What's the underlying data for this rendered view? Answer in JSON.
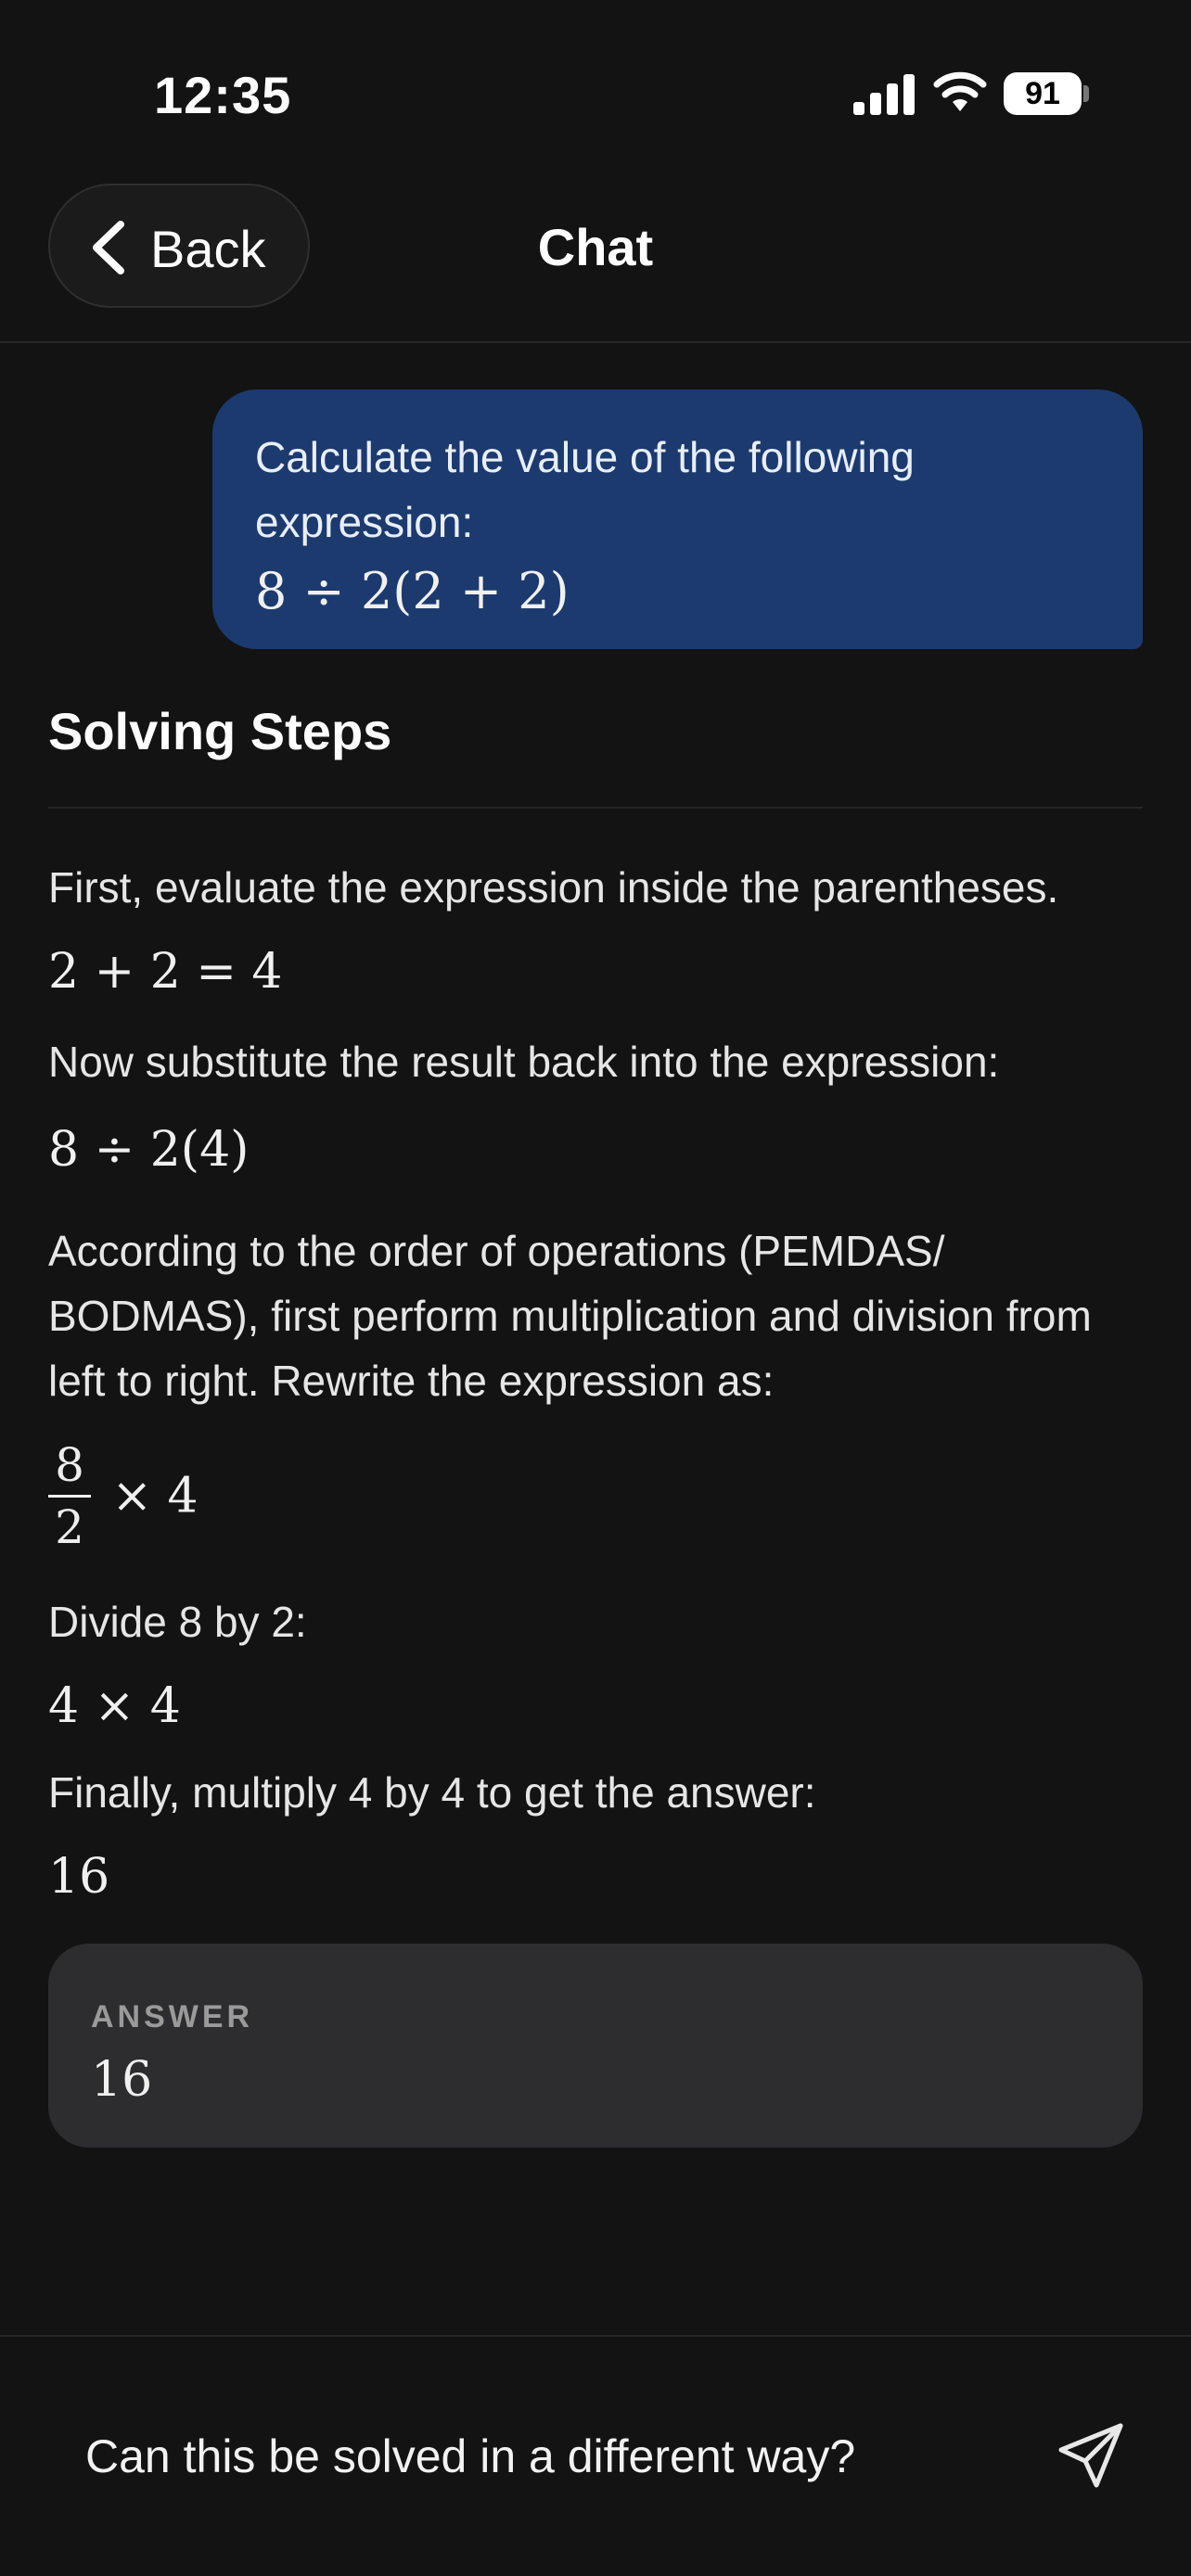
{
  "status": {
    "time": "12:35",
    "battery": "91"
  },
  "nav": {
    "back_label": "Back",
    "title": "Chat"
  },
  "user_message": {
    "text": "Calculate the value of the following expression:",
    "math": "8 ÷ 2(2 + 2)"
  },
  "solution": {
    "title": "Solving Steps",
    "steps": [
      "First, evaluate the expression inside the parentheses.",
      "2 + 2 = 4",
      "Now substitute the result back into the expression:",
      "8 ÷ 2(4)",
      "According to the order of operations (PEMDAS/ BODMAS), first perform multiplication and division from left to right. Rewrite the expression as:",
      "8",
      "2",
      "× 4",
      "Divide 8 by 2:",
      "4 × 4",
      "Finally, multiply 4 by 4 to get the answer:",
      "16"
    ]
  },
  "answer": {
    "label": "ANSWER",
    "value": "16"
  },
  "chat_input": {
    "value": "Can this be solved in a different way?"
  }
}
